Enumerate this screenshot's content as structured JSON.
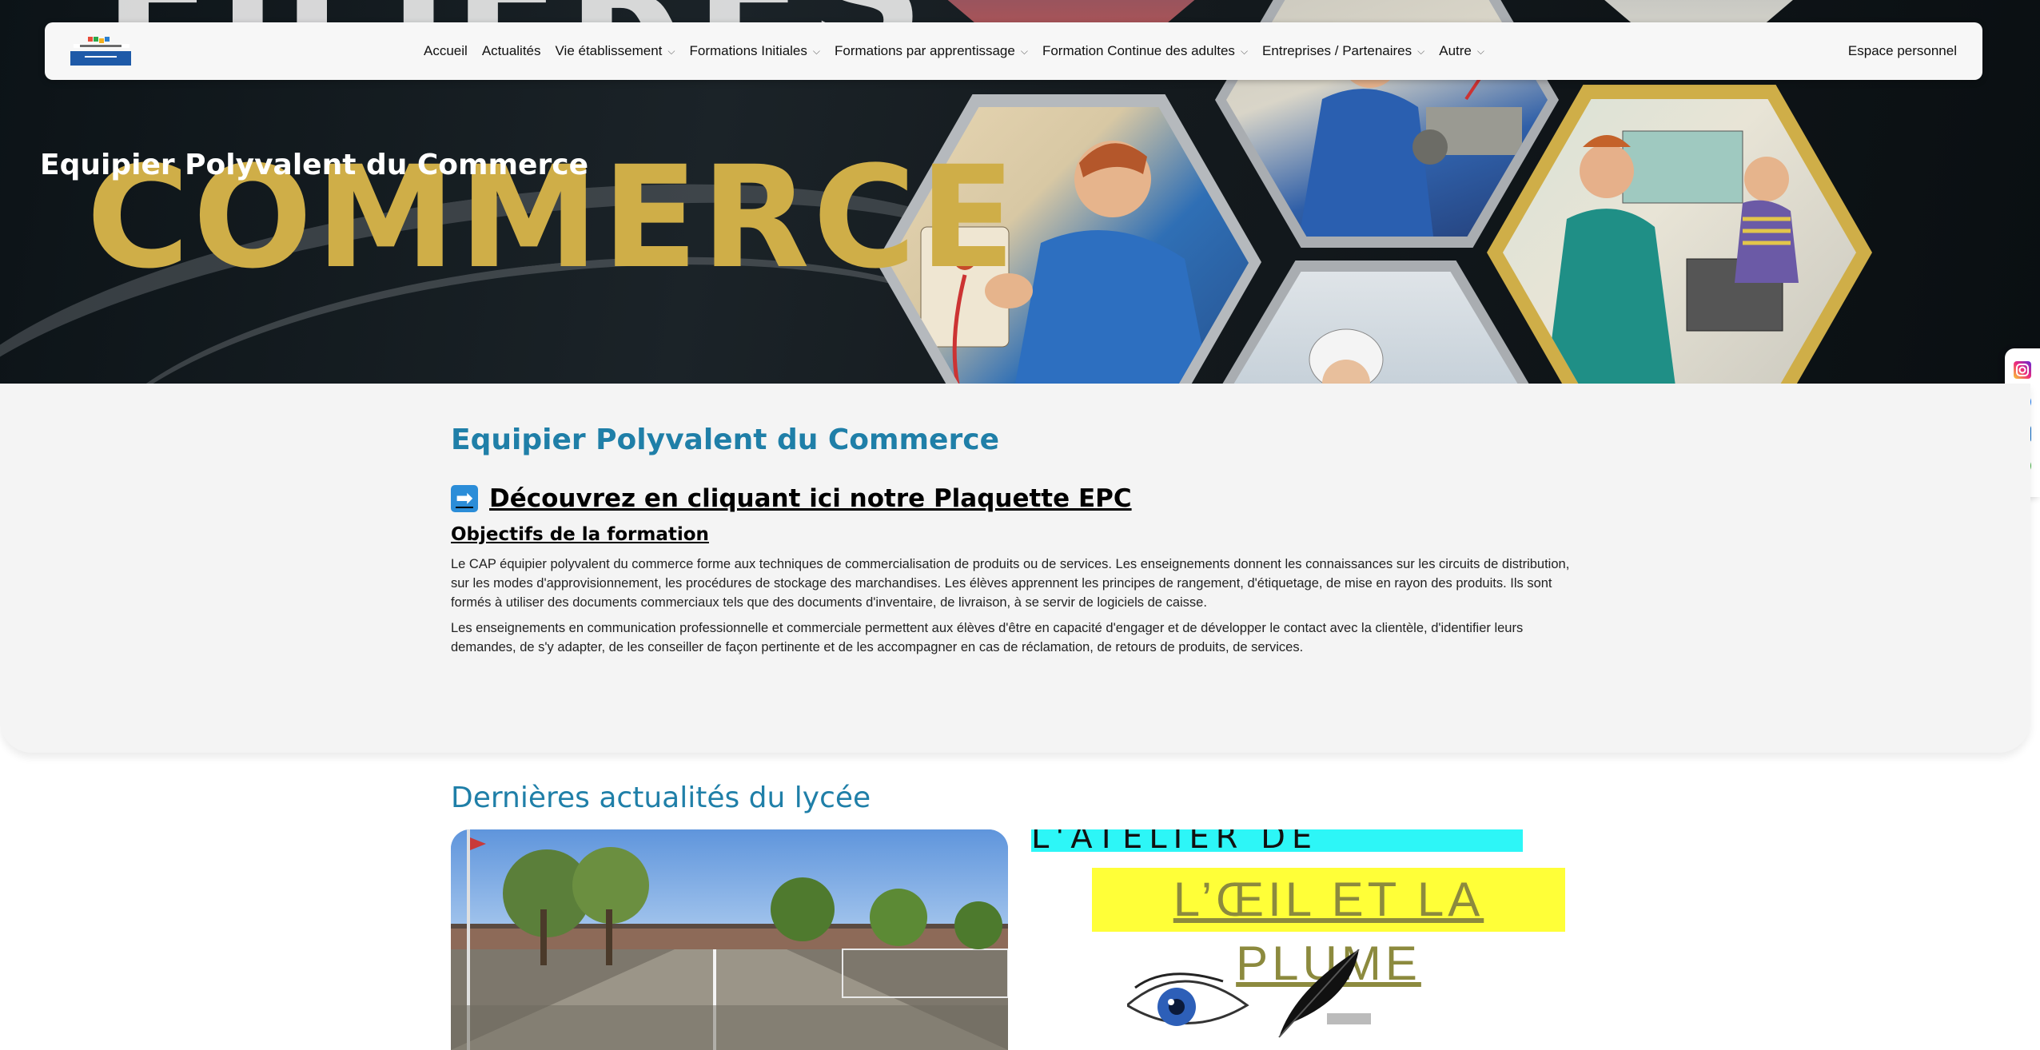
{
  "hero": {
    "title": "Equipier Polyvalent du Commerce",
    "big_word": "COMMERCE",
    "ghost_word": "FILIERES"
  },
  "nav": {
    "items": [
      {
        "label": "Accueil",
        "dropdown": false
      },
      {
        "label": "Actualités",
        "dropdown": false
      },
      {
        "label": "Vie établissement",
        "dropdown": true
      },
      {
        "label": "Formations Initiales",
        "dropdown": true
      },
      {
        "label": "Formations par apprentissage",
        "dropdown": true
      },
      {
        "label": "Formation Continue des adultes",
        "dropdown": true
      },
      {
        "label": "Entreprises / Partenaires",
        "dropdown": true
      },
      {
        "label": "Autre",
        "dropdown": true
      }
    ],
    "espace_label": "Espace personnel",
    "chevron_glyph": "⌵"
  },
  "social": {
    "icons": [
      "instagram-icon",
      "facebook-icon",
      "linkedin-icon",
      "ent-icon"
    ]
  },
  "main": {
    "page_title": "Equipier Polyvalent du Commerce",
    "plaquette_arrow": "➡",
    "plaquette_link": "Découvrez en cliquant ici notre Plaquette EPC",
    "objectifs_heading": "Objectifs de la formation",
    "paragraph1": "Le CAP équipier polyvalent du commerce forme aux techniques de commercialisation de produits ou de services. Les enseignements donnent les connaissances sur les circuits de distribution, sur les modes d'approvisionnement, les procédures de stockage des marchandises. Les élèves apprennent les principes de rangement, d'étiquetage, de mise en rayon des produits. Ils sont formés à utiliser des documents commerciaux tels que des documents d'inventaire, de livraison, à se servir de logiciels de caisse.",
    "paragraph2": "Les enseignements en communication professionnelle et commerciale permettent aux élèves d'être en capacité d'engager et de développer le contact avec la clientèle, d'identifier leurs demandes, de s'y adapter, de les conseiller de façon pertinente et de les accompagner en cas de réclamation, de retours de produits, de services."
  },
  "news": {
    "title": "Dernières actualités du lycée",
    "card2_banner": "L'ATELIER DE LECTURE",
    "card2_heading": "L’ŒIL ET LA PLUME"
  },
  "colors": {
    "accent": "#1f7fa8",
    "gold": "#cfae48",
    "navbar_bg": "#f7f7f7",
    "panel_bg": "#f4f4f4"
  }
}
